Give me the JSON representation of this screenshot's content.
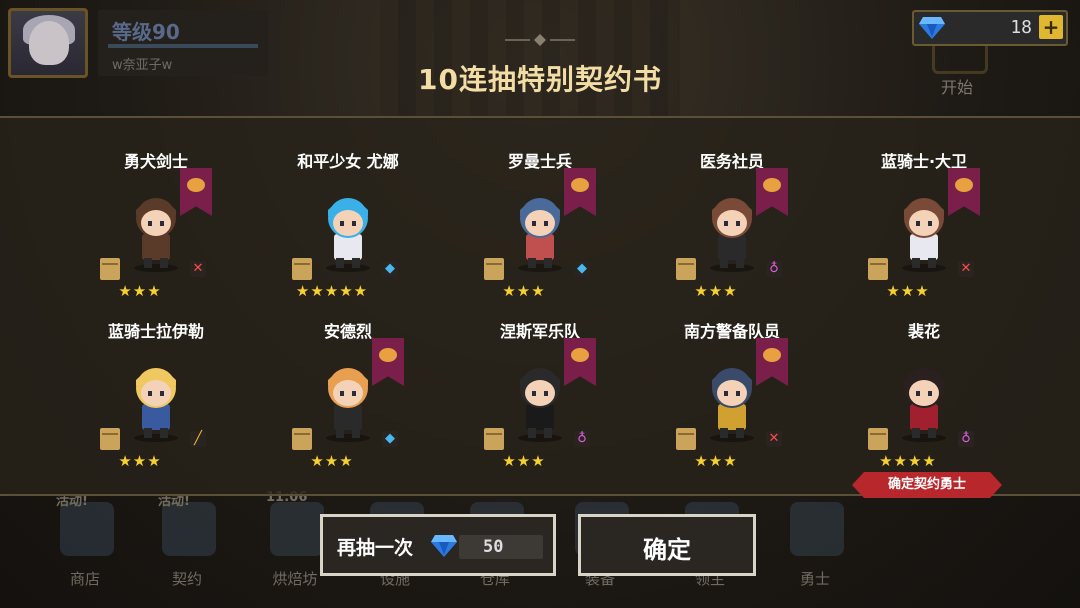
{
  "player": {
    "level": "等级90",
    "name": "w奈亚子w"
  },
  "currency": {
    "gems": "18",
    "plus": "+"
  },
  "title": "10连抽特别契约书",
  "cards": [
    {
      "name": "勇犬剑士",
      "stars": "★★★",
      "weapon": "sword",
      "colors": {
        "hair": "#5a3a28",
        "body": "#5a3a28"
      }
    },
    {
      "name": "和平少女 尤娜",
      "stars": "★★★★★",
      "weapon": "axe",
      "colors": {
        "hair": "#3ab0e8",
        "body": "#e8e8f0"
      }
    },
    {
      "name": "罗曼士兵",
      "stars": "★★★",
      "weapon": "axe",
      "colors": {
        "hair": "#4a6a9a",
        "body": "#c05050"
      }
    },
    {
      "name": "医务社员",
      "stars": "★★★",
      "weapon": "staff",
      "colors": {
        "hair": "#7a4a38",
        "body": "#2a2a2a"
      }
    },
    {
      "name": "蓝骑士·大卫",
      "stars": "★★★",
      "weapon": "sword",
      "colors": {
        "hair": "#7a4a38",
        "body": "#e8e8f0"
      }
    },
    {
      "name": "蓝骑士拉伊勒",
      "stars": "★★★",
      "weapon": "wand",
      "colors": {
        "hair": "#f0c860",
        "body": "#3a5aa0"
      }
    },
    {
      "name": "安德烈",
      "stars": "★★★",
      "weapon": "axe",
      "colors": {
        "hair": "#e8a050",
        "body": "#2a2a2a"
      }
    },
    {
      "name": "涅斯军乐队",
      "stars": "★★★",
      "weapon": "staff",
      "colors": {
        "hair": "#2a2a2a",
        "body": "#1a1a1a"
      }
    },
    {
      "name": "南方警备队员",
      "stars": "★★★",
      "weapon": "sword",
      "colors": {
        "hair": "#3a4a6a",
        "body": "#d0a030"
      }
    },
    {
      "name": "裴花",
      "stars": "★★★★",
      "weapon": "staff",
      "colors": {
        "hair": "#2a2020",
        "body": "#a02030"
      }
    }
  ],
  "confirm_tag": "确定契约勇士",
  "buttons": {
    "redraw": "再抽一次",
    "redraw_cost": "50",
    "ok": "确定"
  },
  "nav": [
    {
      "label": "商店",
      "badge": "活动!"
    },
    {
      "label": "契约",
      "badge": "活动!"
    },
    {
      "label": "烘焙坊",
      "badge": "11:06"
    },
    {
      "label": "设施",
      "badge": ""
    },
    {
      "label": "仓库",
      "badge": ""
    },
    {
      "label": "装备",
      "badge": ""
    },
    {
      "label": "领主",
      "badge": ""
    },
    {
      "label": "勇士",
      "badge": ""
    }
  ],
  "start": {
    "label": "开始"
  },
  "colors": {
    "accent": "#f2dda4",
    "star": "#f5d030",
    "banner": "#7a1f4a",
    "tag": "#b8272c"
  }
}
